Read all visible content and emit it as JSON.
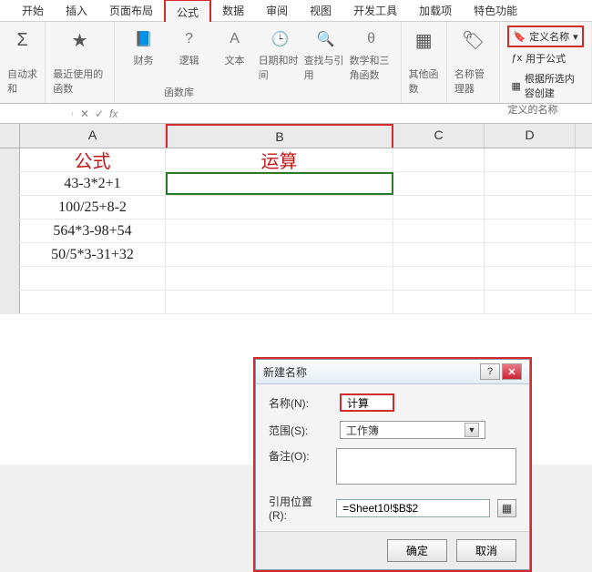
{
  "ribbon": {
    "tabs": [
      "开始",
      "插入",
      "页面布局",
      "公式",
      "数据",
      "审阅",
      "视图",
      "开发工具",
      "加载项",
      "特色功能"
    ],
    "active_tab_index": 3,
    "groups": {
      "autosum": {
        "label": "自动求和",
        "icon": "Σ"
      },
      "recent": {
        "label": "最近使用的函数"
      },
      "financial": "财务",
      "logical": "逻辑",
      "text": "文本",
      "datetime": "日期和时间",
      "lookup": "查找与引用",
      "math": "数学和三角函数",
      "more": "其他函数",
      "fn_lib": "函数库",
      "name_mgr": "名称管理器",
      "define_name": "定义名称",
      "use_in_formula": "用于公式",
      "create_from_sel": "根据所选内容创建",
      "defined_names": "定义的名称"
    }
  },
  "formula_bar": {
    "fx": "fx"
  },
  "columns": {
    "A": "A",
    "B": "B",
    "C": "C",
    "D": "D"
  },
  "cells": {
    "A1": "公式",
    "B1": "运算",
    "A2": "43-3*2+1",
    "A3": "100/25+8-2",
    "A4": "564*3-98+54",
    "A5": "50/5*3-31+32"
  },
  "dialog": {
    "title": "新建名称",
    "name_label": "名称(N):",
    "name_value": "计算",
    "scope_label": "范围(S):",
    "scope_value": "工作簿",
    "comment_label": "备注(O):",
    "ref_label": "引用位置(R):",
    "ref_value": "=Sheet10!$B$2",
    "ok": "确定",
    "cancel": "取消"
  }
}
